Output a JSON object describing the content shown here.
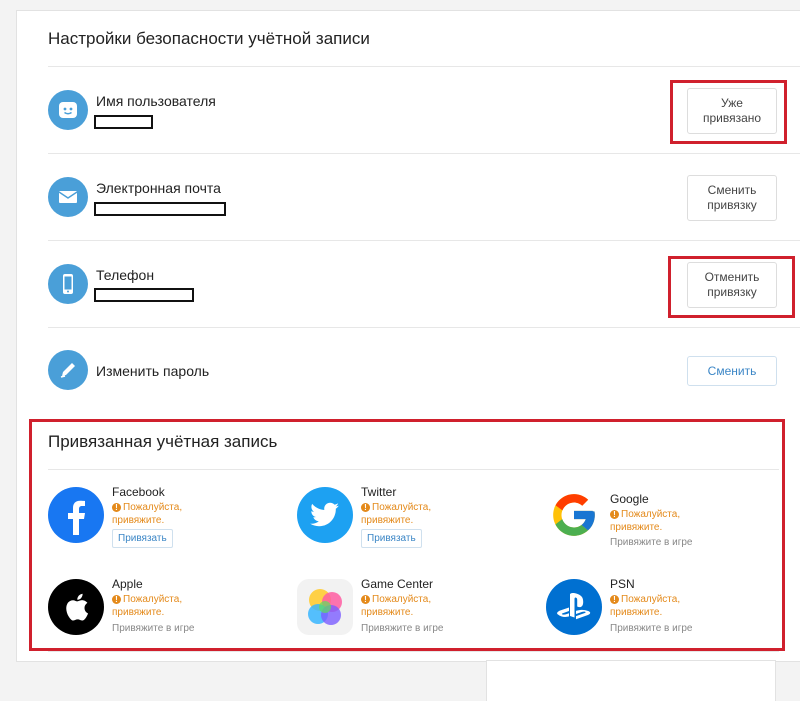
{
  "security": {
    "title": "Настройки безопасности учётной записи",
    "rows": [
      {
        "label": "Имя пользователя",
        "button": "Уже\nпривязано"
      },
      {
        "label": "Электронная почта",
        "button": "Сменить\nпривязку"
      },
      {
        "label": "Телефон",
        "button": "Отменить\nпривязку"
      },
      {
        "label": "Изменить пароль",
        "button": "Сменить"
      }
    ]
  },
  "linked": {
    "title": "Привязанная учётная запись",
    "warning": "Пожалуйста,\nпривяжите.",
    "bind_label": "Привязать",
    "hint": "Привяжите в игре",
    "accounts": [
      {
        "name": "Facebook"
      },
      {
        "name": "Twitter"
      },
      {
        "name": "Google"
      },
      {
        "name": "Apple"
      },
      {
        "name": "Game Center"
      },
      {
        "name": "PSN"
      }
    ]
  },
  "colors": {
    "icon_blue": "#4a9fd8",
    "highlight_red": "#d0202d",
    "warning_orange": "#e48a1b",
    "link_blue": "#3b86c6",
    "facebook": "#1877f2",
    "twitter": "#1da1f2",
    "psn": "#0070d1"
  }
}
